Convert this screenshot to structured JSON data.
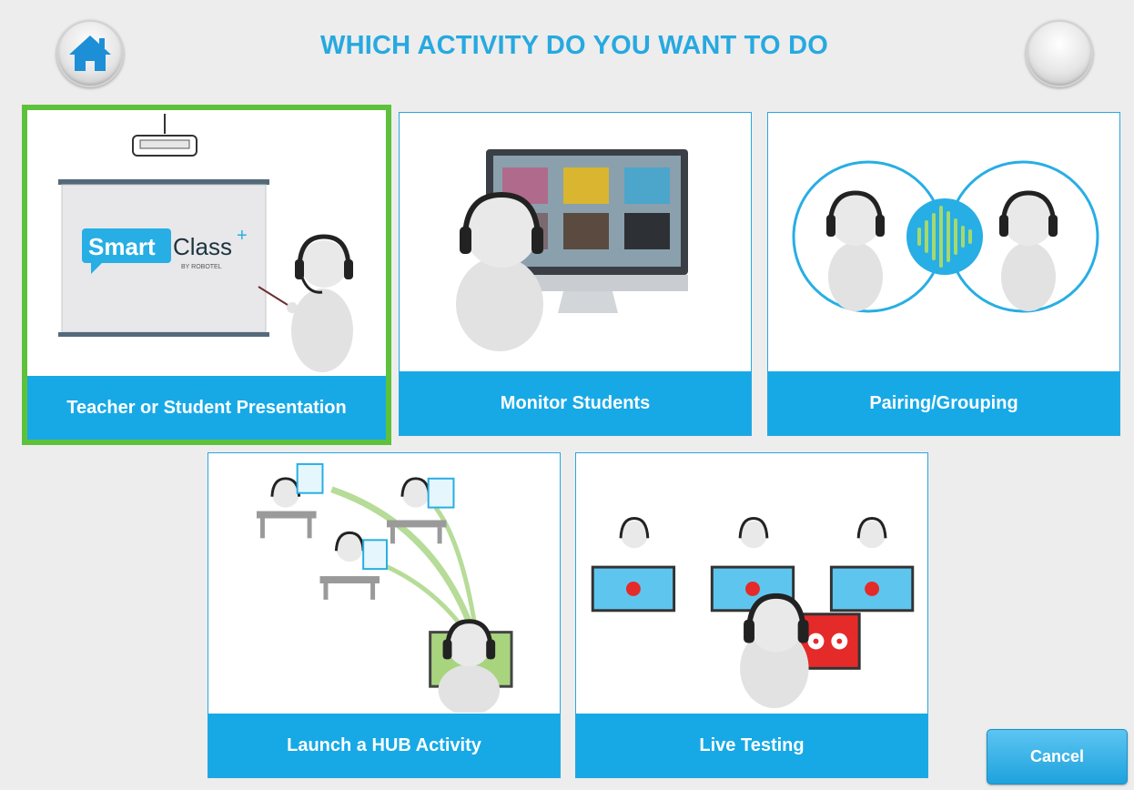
{
  "header": {
    "title": "WHICH ACTIVITY DO YOU WANT TO DO",
    "home_icon": "home-icon"
  },
  "activities": [
    {
      "label": "Teacher or Student Presentation",
      "selected": true,
      "icon": "presentation-illustration",
      "brand_text": "Smart",
      "brand_text2": "Class",
      "brand_sub": "BY ROBOTEL"
    },
    {
      "label": "Monitor Students",
      "selected": false,
      "icon": "monitor-illustration"
    },
    {
      "label": "Pairing/Grouping",
      "selected": false,
      "icon": "pairing-illustration"
    },
    {
      "label": "Launch a HUB Activity",
      "selected": false,
      "icon": "hub-activity-illustration"
    },
    {
      "label": "Live Testing",
      "selected": false,
      "icon": "live-testing-illustration"
    }
  ],
  "footer": {
    "cancel_label": "Cancel"
  },
  "colors": {
    "accent": "#26a9e0",
    "label_bg": "#17a9e6",
    "selected_border": "#5ec13b",
    "background": "#ededed"
  }
}
